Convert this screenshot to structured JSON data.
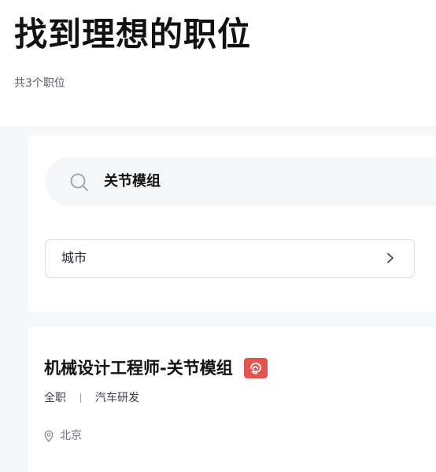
{
  "header": {
    "title": "找到理想的职位",
    "result_count": "共3个职位"
  },
  "search": {
    "value": "关节模组",
    "icon": "search-icon"
  },
  "filters": {
    "city_label": "城市",
    "city_icon": "chevron-right-icon"
  },
  "jobs": [
    {
      "title": "机械设计工程师-关节模组",
      "badge_icon": "hot-badge-icon",
      "type": "全职",
      "category": "汽车研发",
      "location": "北京",
      "location_icon": "location-pin-icon"
    }
  ],
  "colors": {
    "background": "#f6f7f9",
    "card": "#ffffff",
    "badge": "#e4544e",
    "search_bg": "#f5f6f8"
  }
}
